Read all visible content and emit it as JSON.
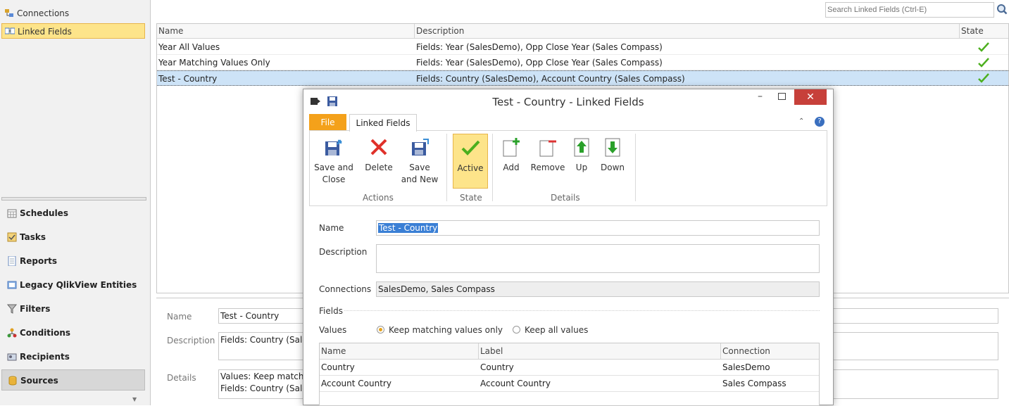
{
  "sidebar": {
    "tree": [
      {
        "label": "Connections",
        "icon": "connections-icon",
        "selected": false
      },
      {
        "label": "Linked Fields",
        "icon": "linked-fields-icon",
        "selected": true
      }
    ],
    "nav": [
      {
        "label": "Schedules",
        "icon": "schedules-icon"
      },
      {
        "label": "Tasks",
        "icon": "tasks-icon"
      },
      {
        "label": "Reports",
        "icon": "reports-icon"
      },
      {
        "label": "Legacy QlikView Entities",
        "icon": "legacy-icon"
      },
      {
        "label": "Filters",
        "icon": "filter-icon"
      },
      {
        "label": "Conditions",
        "icon": "conditions-icon"
      },
      {
        "label": "Recipients",
        "icon": "recipients-icon"
      },
      {
        "label": "Sources",
        "icon": "sources-icon",
        "selected": true
      }
    ]
  },
  "search": {
    "placeholder": "Search Linked Fields (Ctrl-E)"
  },
  "grid": {
    "columns": [
      "Name",
      "Description",
      "State"
    ],
    "rows": [
      {
        "name": "Year All Values",
        "description": "Fields: Year (SalesDemo), Opp Close Year (Sales Compass)",
        "state": "active"
      },
      {
        "name": "Year Matching Values Only",
        "description": "Fields: Year (SalesDemo), Opp Close Year (Sales Compass)",
        "state": "active"
      },
      {
        "name": "Test - Country",
        "description": "Fields: Country (SalesDemo), Account Country (Sales Compass)",
        "state": "active",
        "selected": true
      }
    ]
  },
  "detail": {
    "name_label": "Name",
    "name_value": "Test - Country",
    "description_label": "Description",
    "description_value": "Fields: Country (Sale",
    "details_label": "Details",
    "details_line1": "Values: Keep matchi",
    "details_line2": "Fields: Country (Sale"
  },
  "dialog": {
    "title": "Test - Country - Linked Fields",
    "tab_file": "File",
    "tab_linked": "Linked Fields",
    "ribbon": {
      "save_close_1": "Save and",
      "save_close_2": "Close",
      "delete": "Delete",
      "save_new_1": "Save",
      "save_new_2": "and New",
      "active": "Active",
      "add": "Add",
      "remove": "Remove",
      "up": "Up",
      "down": "Down",
      "group_actions": "Actions",
      "group_state": "State",
      "group_details": "Details"
    },
    "name_label": "Name",
    "name_value": "Test - Country",
    "description_label": "Description",
    "description_value": "",
    "connections_label": "Connections",
    "connections_value": "SalesDemo, Sales Compass",
    "fields_label": "Fields",
    "values_label": "Values",
    "option_matching": "Keep matching values only",
    "option_all": "Keep all values",
    "fields_table": {
      "columns": [
        "Name",
        "Label",
        "Connection"
      ],
      "rows": [
        {
          "name": "Country",
          "label": "Country",
          "connection": "SalesDemo"
        },
        {
          "name": "Account Country",
          "label": "Account Country",
          "connection": "Sales Compass"
        }
      ]
    }
  },
  "colors": {
    "accent": "#fde48a",
    "file_tab": "#f4a11a",
    "check": "#4caf1e",
    "close": "#c7403a"
  }
}
